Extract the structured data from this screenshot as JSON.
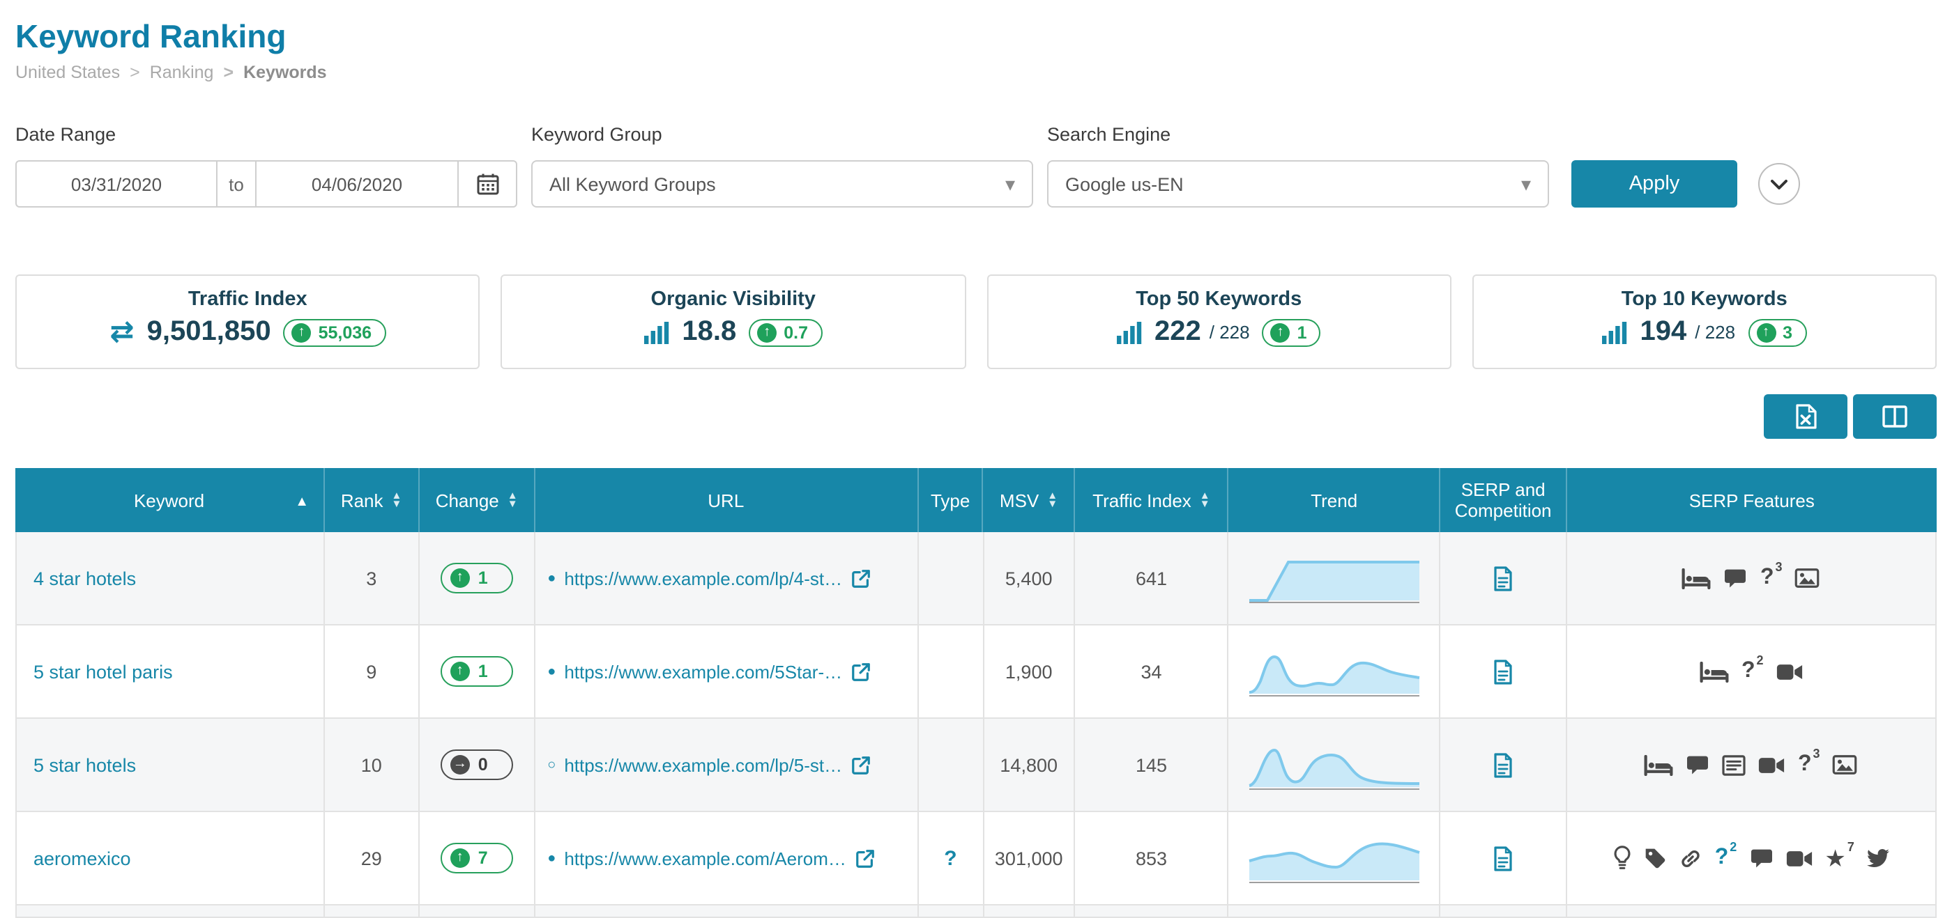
{
  "colors": {
    "accent": "#1787A8",
    "green": "#1FA15B",
    "title": "#0F7EA8",
    "header_bg": "#1787A8"
  },
  "page": {
    "title": "Keyword Ranking",
    "breadcrumb": {
      "items": [
        "United States",
        "Ranking",
        "Keywords"
      ]
    }
  },
  "filters": {
    "date_range": {
      "label": "Date Range",
      "from": "03/31/2020",
      "to_label": "to",
      "to": "04/06/2020",
      "calendar_icon": "calendar-icon"
    },
    "keyword_group": {
      "label": "Keyword Group",
      "value": "All Keyword Groups"
    },
    "search_engine": {
      "label": "Search Engine",
      "value": "Google us-EN"
    },
    "apply_label": "Apply",
    "expand_icon": "chevron-down-icon"
  },
  "metrics": {
    "cards": [
      {
        "title": "Traffic Index",
        "icon": "swap-arrows-icon",
        "icon_glyph": "⇄",
        "value": "9,501,850",
        "delta": "55,036",
        "delta_arrow": "↑",
        "delta_dir": "up"
      },
      {
        "title": "Organic Visibility",
        "icon": "bar-chart-icon",
        "value": "18.8",
        "delta": "0.7",
        "delta_arrow": "↑",
        "delta_dir": "up"
      },
      {
        "title": "Top 50 Keywords",
        "icon": "bar-chart-icon",
        "value": "222",
        "total": "/ 228",
        "delta": "1",
        "delta_arrow": "↑",
        "delta_dir": "up"
      },
      {
        "title": "Top 10 Keywords",
        "icon": "bar-chart-icon",
        "value": "194",
        "total": "/ 228",
        "delta": "3",
        "delta_arrow": "↑",
        "delta_dir": "up"
      }
    ]
  },
  "toolbar": {
    "buttons": [
      {
        "icon": "excel-export-icon"
      },
      {
        "icon": "toggle-columns-icon"
      }
    ]
  },
  "table": {
    "columns": [
      {
        "label": "Keyword",
        "sort": "asc"
      },
      {
        "label": "Rank",
        "sort": "both"
      },
      {
        "label": "Change",
        "sort": "both"
      },
      {
        "label": "URL"
      },
      {
        "label": "Type"
      },
      {
        "label": "MSV",
        "sort": "both"
      },
      {
        "label": "Traffic Index",
        "sort": "both"
      },
      {
        "label": "Trend"
      },
      {
        "label": "SERP and Competition"
      },
      {
        "label": "SERP Features"
      }
    ],
    "rows": [
      {
        "keyword": "4 star hotels",
        "rank": "3",
        "change": "1",
        "change_arrow": "↑",
        "change_dir": "up",
        "bullet": "●",
        "url": "https://www.example.com/lp/4-st…",
        "type": "",
        "msv": "5,400",
        "traffic_index": "641",
        "serp_competition_icon": "document-icon",
        "serp_features": [
          "hotel-pack-icon",
          "reviews-icon",
          "questions-icon",
          "image-pack-icon"
        ],
        "sups": {
          "question": "3"
        }
      },
      {
        "keyword": "5 star hotel paris",
        "rank": "9",
        "change": "1",
        "change_arrow": "↑",
        "change_dir": "up",
        "bullet": "●",
        "url": "https://www.example.com/5Star-…",
        "type": "",
        "msv": "1,900",
        "traffic_index": "34",
        "serp_competition_icon": "document-icon",
        "serp_features": [
          "hotel-pack-icon",
          "questions-icon",
          "video-icon"
        ],
        "sups": {
          "question": "2"
        }
      },
      {
        "keyword": "5 star hotels",
        "rank": "10",
        "change": "0",
        "change_arrow": "→",
        "change_dir": "zero",
        "bullet": "○",
        "url": "https://www.example.com/lp/5-st…",
        "type": "",
        "msv": "14,800",
        "traffic_index": "145",
        "serp_competition_icon": "document-icon",
        "serp_features": [
          "hotel-pack-icon",
          "reviews-icon",
          "news-icon",
          "video-icon",
          "questions-icon",
          "image-pack-icon"
        ],
        "sups": {
          "question": "3"
        }
      },
      {
        "keyword": "aeromexico",
        "rank": "29",
        "change": "7",
        "change_arrow": "↑",
        "change_dir": "up",
        "bullet": "●",
        "url": "https://www.example.com/Aerom…",
        "type": "?",
        "msv": "301,000",
        "traffic_index": "853",
        "serp_competition_icon": "document-icon",
        "serp_features": [
          "ads-icon",
          "tag-icon",
          "links-icon",
          "questions-icon",
          "reviews-icon",
          "video-icon",
          "rating-star-icon",
          "twitter-icon"
        ],
        "sups": {
          "question": "2",
          "star": "7"
        }
      }
    ]
  }
}
